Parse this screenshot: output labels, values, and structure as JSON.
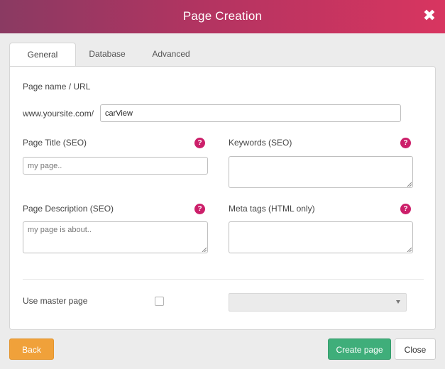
{
  "dialog": {
    "title": "Page Creation",
    "close_glyph": "✖",
    "close_icon": "close-icon"
  },
  "tabs": [
    {
      "label": "General",
      "active": true
    },
    {
      "label": "Database",
      "active": false
    },
    {
      "label": "Advanced",
      "active": false
    }
  ],
  "form": {
    "page_name_label": "Page name / URL",
    "url_prefix": "www.yoursite.com/",
    "page_name_value": "carView",
    "page_title_label": "Page Title (SEO)",
    "page_title_placeholder": "my page..",
    "keywords_label": "Keywords (SEO)",
    "keywords_value": "",
    "description_label": "Page Description (SEO)",
    "description_placeholder": "my page is about..",
    "meta_tags_label": "Meta tags (HTML only)",
    "meta_tags_value": "",
    "master_page_label": "Use master page",
    "master_page_checked": false,
    "master_page_selected": "",
    "help_glyph": "?",
    "help_icon": "help-icon",
    "help_color": "#cc1f6a"
  },
  "footer": {
    "back_label": "Back",
    "create_label": "Create page",
    "close_label": "Close"
  },
  "colors": {
    "header_gradient_start": "#8a3a62",
    "header_gradient_end": "#d83560",
    "back_button": "#f0a13a",
    "create_button": "#3fae7a"
  }
}
